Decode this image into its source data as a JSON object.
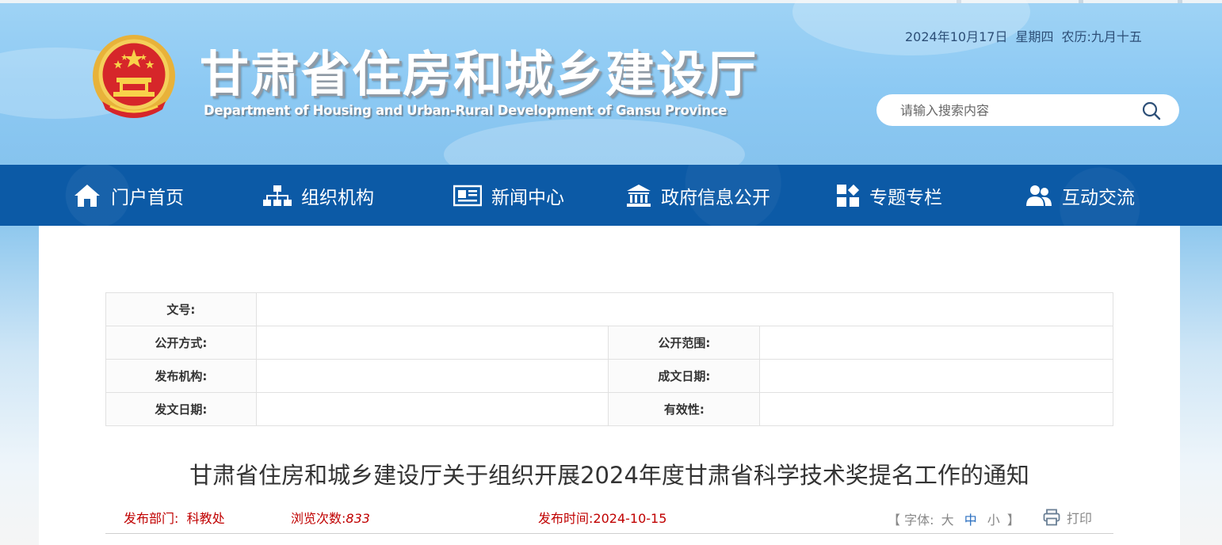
{
  "header": {
    "title": "甘肃省住房和城乡建设厅",
    "subtitle": "Department of Housing and Urban-Rural Development of Gansu Province",
    "date": "2024年10月17日",
    "weekday": "星期四",
    "lunar": "农历:九月十五",
    "search_placeholder": "请输入搜索内容"
  },
  "nav": {
    "items": [
      {
        "label": "门户首页",
        "icon": "home-icon"
      },
      {
        "label": "组织机构",
        "icon": "org-chart-icon"
      },
      {
        "label": "新闻中心",
        "icon": "newspaper-icon"
      },
      {
        "label": "政府信息公开",
        "icon": "government-building-icon"
      },
      {
        "label": "专题专栏",
        "icon": "grid-tiles-icon"
      },
      {
        "label": "互动交流",
        "icon": "users-icon"
      }
    ]
  },
  "meta_table": {
    "doc_no_label": "文号:",
    "disclosure_method_label": "公开方式:",
    "disclosure_scope_label": "公开范围:",
    "issuer_label": "发布机构:",
    "creation_date_label": "成文日期:",
    "issue_date_label": "发文日期:",
    "validity_label": "有效性:"
  },
  "article": {
    "title": "甘肃省住房和城乡建设厅关于组织开展2024年度甘肃省科学技术奖提名工作的通知",
    "department_label": "发布部门:",
    "department": "科教处",
    "views_label": "浏览次数:",
    "views": "833",
    "publish_label": "发布时间:",
    "publish_date": "2024-10-15",
    "font_label_open": "【 字体:",
    "font_large": "大",
    "font_medium": "中",
    "font_small": "小",
    "font_label_close": "】",
    "print_label": "打印"
  },
  "colors": {
    "nav_bg": "#0c5aa6",
    "info_red": "#c00000",
    "header_sky": "#8cc9f3"
  }
}
